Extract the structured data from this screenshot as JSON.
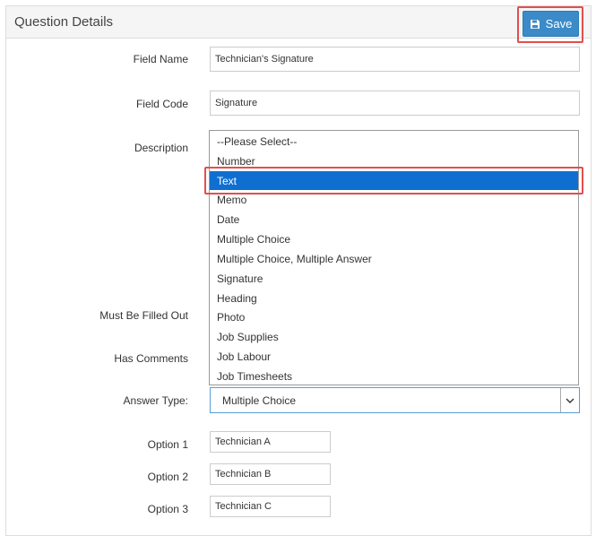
{
  "header": {
    "title": "Question Details",
    "save_label": "Save"
  },
  "fields": {
    "field_name": {
      "label": "Field Name",
      "value": "Technician's Signature"
    },
    "field_code": {
      "label": "Field Code",
      "value": "Signature"
    },
    "description": {
      "label": "Description"
    },
    "must_be_filled_out": {
      "label": "Must Be Filled Out"
    },
    "has_comments": {
      "label": "Has Comments"
    },
    "answer_type": {
      "label": "Answer Type:",
      "value": "Multiple Choice"
    }
  },
  "dropdown": {
    "options": [
      "--Please Select--",
      "Number",
      "Text",
      "Memo",
      "Date",
      "Multiple Choice",
      "Multiple Choice, Multiple Answer",
      "Signature",
      "Heading",
      "Photo",
      "Job Supplies",
      "Job Labour",
      "Job Timesheets"
    ],
    "highlighted": "Text"
  },
  "options": [
    {
      "label": "Option 1",
      "value": "Technician A"
    },
    {
      "label": "Option 2",
      "value": "Technician B"
    },
    {
      "label": "Option 3",
      "value": "Technician C"
    }
  ],
  "colors": {
    "accent": "#3b8bc9",
    "highlight_border": "#e14f4f",
    "selected_option": "#0f6fd1"
  }
}
